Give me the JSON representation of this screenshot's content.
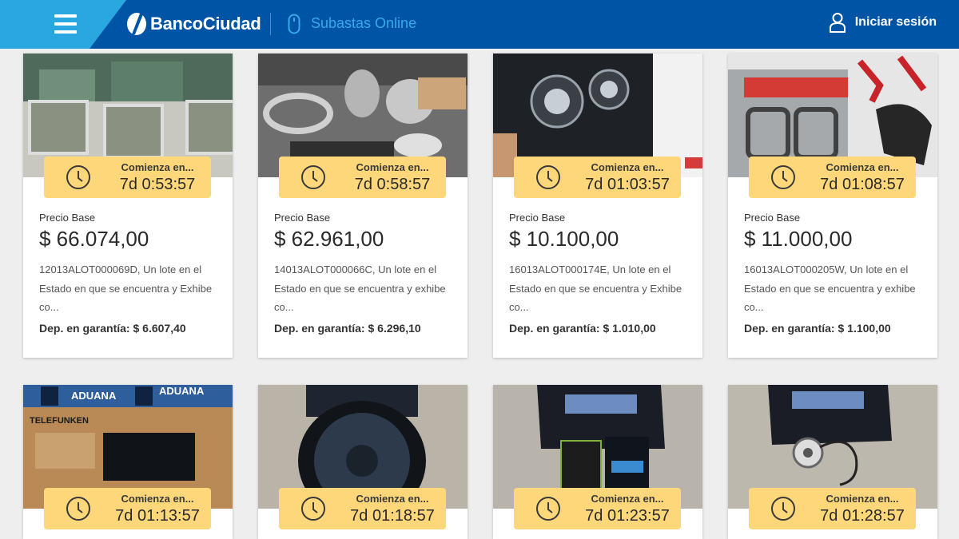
{
  "header": {
    "brand": "BancoCiudad",
    "subtitle": "Subastas Online",
    "login_label": "Iniciar sesión"
  },
  "colors": {
    "header_bg": "#0054a6",
    "header_accent": "#29a8e0",
    "timer_bg": "#fdd77a"
  },
  "lots": [
    {
      "timer_label": "Comienza en...",
      "countdown": "7d 0:53:57",
      "price_label": "Precio Base",
      "price": "$ 66.074,00",
      "desc": "12013ALOT000069D, Un lote en el Estado en que se encuentra y Exhibe co...",
      "deposit_label": "Dep. en garantía:",
      "deposit_value": "$ 6.607,40"
    },
    {
      "timer_label": "Comienza en...",
      "countdown": "7d 0:58:57",
      "price_label": "Precio Base",
      "price": "$ 62.961,00",
      "desc": "14013ALOT000066C, Un lote en el Estado en que se encuentra y exhibe co...",
      "deposit_label": "Dep. en garantía:",
      "deposit_value": "$ 6.296,10"
    },
    {
      "timer_label": "Comienza en...",
      "countdown": "7d 01:03:57",
      "price_label": "Precio Base",
      "price": "$ 10.100,00",
      "desc": "16013ALOT000174E, Un lote en el Estado en que se encuentra y Exhibe co...",
      "deposit_label": "Dep. en garantía:",
      "deposit_value": "$ 1.010,00"
    },
    {
      "timer_label": "Comienza en...",
      "countdown": "7d 01:08:57",
      "price_label": "Precio Base",
      "price": "$ 11.000,00",
      "desc": "16013ALOT000205W, Un lote en el Estado en que se encuentra y exhibe co...",
      "deposit_label": "Dep. en garantía:",
      "deposit_value": "$ 1.100,00"
    },
    {
      "timer_label": "Comienza en...",
      "countdown": "7d 01:13:57",
      "image_text": {
        "stamp": "ADUANA",
        "brand": "TELEFUNKEN"
      }
    },
    {
      "timer_label": "Comienza en...",
      "countdown": "7d 01:18:57"
    },
    {
      "timer_label": "Comienza en...",
      "countdown": "7d 01:23:57"
    },
    {
      "timer_label": "Comienza en...",
      "countdown": "7d 01:28:57"
    }
  ]
}
